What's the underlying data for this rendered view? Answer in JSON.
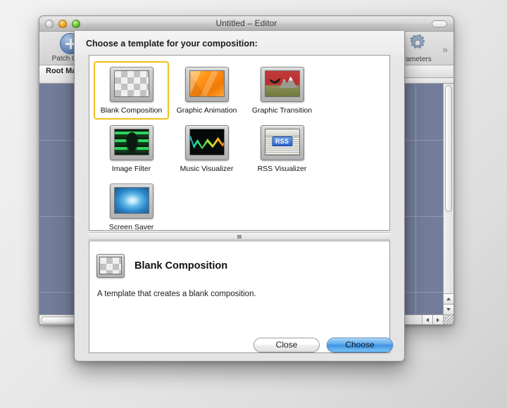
{
  "background_window": {
    "title": "Untitled – Editor",
    "traffic_lights": [
      "close",
      "minimize",
      "zoom"
    ],
    "toolbar": {
      "items": [
        {
          "label": "Patch Creat",
          "icon": "plus-circle-icon"
        },
        {
          "label": "rameters",
          "icon": "gear-icon"
        }
      ],
      "overflow_glyph": "»"
    },
    "tab": {
      "label": "Root Macr"
    },
    "canvas": {
      "background_color": "#737d9b",
      "grid": true
    }
  },
  "sheet": {
    "title": "Choose a template for your composition:",
    "templates": [
      {
        "id": "blank-composition",
        "label": "Blank Composition",
        "art": "art-checker",
        "selected": true
      },
      {
        "id": "graphic-animation",
        "label": "Graphic Animation",
        "art": "art-orange",
        "selected": false
      },
      {
        "id": "graphic-transition",
        "label": "Graphic Transition",
        "art": "art-landscape",
        "selected": false
      },
      {
        "id": "image-filter",
        "label": "Image Filter",
        "art": "art-green",
        "selected": false
      },
      {
        "id": "music-visualizer",
        "label": "Music Visualizer",
        "art": "art-music",
        "selected": false
      },
      {
        "id": "rss-visualizer",
        "label": "RSS Visualizer",
        "art": "art-rss",
        "selected": false,
        "badge": "RSS"
      },
      {
        "id": "screen-saver",
        "label": "Screen Saver",
        "art": "art-blue",
        "selected": false
      }
    ],
    "detail": {
      "title": "Blank Composition",
      "description": "A template that creates a blank composition.",
      "art": "art-checker"
    },
    "buttons": {
      "close": "Close",
      "choose": "Choose"
    },
    "selection_color": "#f0c020",
    "default_button_color": "#3f93e2"
  }
}
